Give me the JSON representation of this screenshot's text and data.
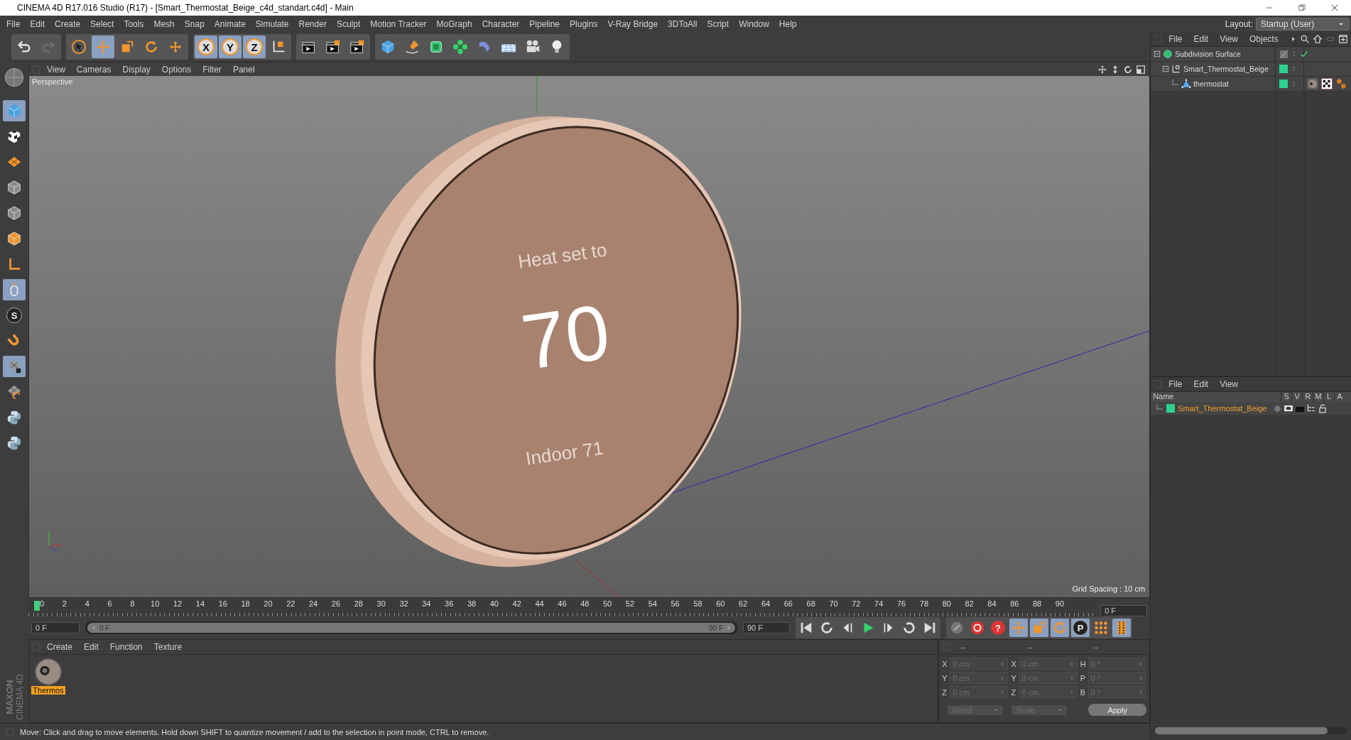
{
  "window": {
    "title": "CINEMA 4D R17.016 Studio (R17) - [Smart_Thermostat_Beige_c4d_standart.c4d] - Main"
  },
  "menu": [
    "File",
    "Edit",
    "Create",
    "Select",
    "Tools",
    "Mesh",
    "Snap",
    "Animate",
    "Simulate",
    "Render",
    "Sculpt",
    "Motion Tracker",
    "MoGraph",
    "Character",
    "Pipeline",
    "Plugins",
    "V-Ray Bridge",
    "3DToAll",
    "Script",
    "Window",
    "Help"
  ],
  "layout": {
    "label": "Layout:",
    "value": "Startup (User)"
  },
  "toolbar": [
    [
      {
        "kind": "undo",
        "active": false
      },
      {
        "kind": "redo",
        "active": false
      }
    ],
    [
      {
        "kind": "select",
        "active": false
      },
      {
        "kind": "move",
        "active": true
      },
      {
        "kind": "scale",
        "active": false
      },
      {
        "kind": "rotate",
        "active": false
      },
      {
        "kind": "moveplus",
        "active": false
      }
    ],
    [
      {
        "kind": "axis",
        "label": "X",
        "active": true
      },
      {
        "kind": "axis",
        "label": "Y",
        "active": true
      },
      {
        "kind": "axis",
        "label": "Z",
        "active": true
      },
      {
        "kind": "coord",
        "active": false
      }
    ],
    [
      {
        "kind": "clapper",
        "active": false
      },
      {
        "kind": "clapper2",
        "active": false
      },
      {
        "kind": "clapper3",
        "active": false
      }
    ],
    [
      {
        "kind": "cube",
        "active": false
      },
      {
        "kind": "pen",
        "active": false
      },
      {
        "kind": "subdiv",
        "active": false
      },
      {
        "kind": "cloner",
        "active": false
      },
      {
        "kind": "deformer",
        "active": false
      },
      {
        "kind": "floor",
        "active": false
      },
      {
        "kind": "camera",
        "active": false
      },
      {
        "kind": "light",
        "active": false
      }
    ]
  ],
  "tools": [
    {
      "kind": "sphere",
      "active": false
    },
    {
      "kind": "cube",
      "active": true
    },
    {
      "kind": "checker",
      "active": false
    },
    {
      "kind": "plane",
      "active": false
    },
    {
      "kind": "pointcube",
      "active": false
    },
    {
      "kind": "edgecube",
      "active": false
    },
    {
      "kind": "polycube",
      "active": false
    },
    {
      "kind": "axisl",
      "active": false
    },
    {
      "kind": "mouse",
      "active": true
    },
    {
      "kind": "badge",
      "label": "S",
      "active": false
    },
    {
      "kind": "magnet",
      "active": false
    },
    {
      "kind": "lockgrid",
      "active": true
    },
    {
      "kind": "swirlgrid",
      "active": false
    },
    {
      "kind": "python",
      "active": false
    },
    {
      "kind": "python",
      "active": false
    }
  ],
  "viewport": {
    "menu": [
      "View",
      "Cameras",
      "Display",
      "Options",
      "Filter",
      "Panel"
    ],
    "nav": [
      {
        "kind": "move"
      },
      {
        "kind": "updown"
      },
      {
        "kind": "rotate"
      },
      {
        "kind": "maximize"
      }
    ],
    "camera": "Perspective",
    "grid": "Grid Spacing : 10 cm",
    "screen": [
      "Heat set to",
      "70",
      "Indoor 71"
    ]
  },
  "objects": {
    "menu": [
      "File",
      "Edit",
      "View",
      "Objects"
    ],
    "tree": [
      {
        "name": "Subdivision Surface",
        "kind": "subdiv",
        "checked": true,
        "expanded": true,
        "children": [
          {
            "name": "Smart_Thermostat_Beige",
            "kind": "null",
            "color": "#2fd08f",
            "checked": false,
            "expanded": true,
            "children": [
              {
                "name": "thermostat",
                "kind": "poly",
                "color": "#2fd08f",
                "checked": false,
                "tags": [
                  {
                    "kind": "material"
                  },
                  {
                    "kind": "checker"
                  },
                  {
                    "kind": "phong"
                  }
                ]
              }
            ]
          }
        ]
      }
    ]
  },
  "layers": {
    "menu": [
      "File",
      "Edit",
      "View"
    ],
    "columns": [
      "Name",
      "S",
      "V",
      "R",
      "M",
      "L",
      "A"
    ],
    "rows": [
      {
        "name": "Smart_Thermostat_Beige",
        "color": "#2fd08f"
      }
    ]
  },
  "timeline": {
    "ticks": [
      "0",
      "2",
      "4",
      "6",
      "8",
      "10",
      "12",
      "14",
      "16",
      "18",
      "20",
      "22",
      "24",
      "26",
      "28",
      "30",
      "32",
      "34",
      "36",
      "38",
      "40",
      "42",
      "44",
      "46",
      "48",
      "50",
      "52",
      "54",
      "56",
      "58",
      "60",
      "62",
      "64",
      "66",
      "68",
      "70",
      "72",
      "74",
      "76",
      "78",
      "80",
      "82",
      "84",
      "86",
      "88",
      "90"
    ],
    "current": "0 F",
    "start": "0 F",
    "range_start": "0 F",
    "range_end": "90 F",
    "level": 1,
    "end": "90 F",
    "transport": [
      {
        "kind": "first"
      },
      {
        "kind": "prevkey"
      },
      {
        "kind": "prevframe"
      },
      {
        "kind": "play"
      },
      {
        "kind": "nextframe"
      },
      {
        "kind": "nextkey"
      },
      {
        "kind": "last"
      }
    ],
    "keys": [
      {
        "kind": "keysel",
        "active": false
      },
      {
        "kind": "autokey",
        "active": false
      },
      {
        "kind": "help",
        "label": "?",
        "active": false
      },
      {
        "kind": "move",
        "active": true
      },
      {
        "kind": "scale",
        "active": true
      },
      {
        "kind": "rotate",
        "active": true
      },
      {
        "kind": "badge",
        "label": "P",
        "active": true
      },
      {
        "kind": "dots",
        "active": false
      },
      {
        "kind": "film",
        "active": true
      }
    ]
  },
  "materials": {
    "menu": [
      "Create",
      "Edit",
      "Function",
      "Texture"
    ],
    "items": [
      {
        "name": "Thermos",
        "selected": true
      }
    ]
  },
  "coordinates": {
    "disabled": true,
    "headers": [
      "--",
      "--",
      "--"
    ],
    "columns": [
      [
        {
          "axis": "X",
          "value": "0 cm"
        },
        {
          "axis": "Y",
          "value": "0 cm"
        },
        {
          "axis": "Z",
          "value": "0 cm"
        }
      ],
      [
        {
          "axis": "X",
          "value": "0 cm"
        },
        {
          "axis": "Y",
          "value": "0 cm"
        },
        {
          "axis": "Z",
          "value": "0 cm"
        }
      ],
      [
        {
          "axis": "H",
          "value": "0 °"
        },
        {
          "axis": "P",
          "value": "0 °"
        },
        {
          "axis": "B",
          "value": "0 °"
        }
      ]
    ],
    "dropdowns": [
      "World",
      "Scale"
    ],
    "apply": "Apply"
  },
  "logo": [
    "MAXON",
    "CINEMA 4D"
  ],
  "status": "Move: Click and drag to move elements. Hold down SHIFT to quantize movement / add to the selection in point mode, CTRL to remove."
}
